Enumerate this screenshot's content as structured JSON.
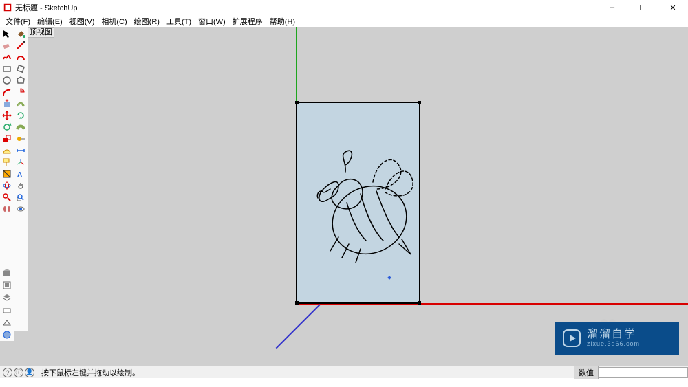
{
  "titlebar": {
    "title": "无标题 - SketchUp",
    "min": "–",
    "max": "☐",
    "close": "✕"
  },
  "menubar": {
    "items": [
      "文件(F)",
      "编辑(E)",
      "视图(V)",
      "相机(C)",
      "绘图(R)",
      "工具(T)",
      "窗口(W)",
      "扩展程序",
      "帮助(H)"
    ]
  },
  "viewport": {
    "label": "顶视图"
  },
  "statusbar": {
    "hint": "按下鼠标左键并拖动以绘制。",
    "measurement_label": "数值",
    "icons": [
      "①",
      "⊙",
      "⊙"
    ]
  },
  "tools_left": [
    {
      "name": "select",
      "col": 0
    },
    {
      "name": "paint-bucket",
      "col": 1
    },
    {
      "name": "eraser",
      "col": 0
    },
    {
      "name": "line",
      "col": 1
    },
    {
      "name": "freehand",
      "col": 0
    },
    {
      "name": "curve-red",
      "col": 1
    },
    {
      "name": "rectangle",
      "col": 0
    },
    {
      "name": "rotated-rect",
      "col": 1
    },
    {
      "name": "circle",
      "col": 0
    },
    {
      "name": "polygon",
      "col": 1
    },
    {
      "name": "arc-red",
      "col": 0
    },
    {
      "name": "pie-red",
      "col": 1
    },
    {
      "name": "pushpull",
      "col": 0
    },
    {
      "name": "offset",
      "col": 1
    },
    {
      "name": "move",
      "col": 0
    },
    {
      "name": "rotate",
      "col": 1
    },
    {
      "name": "rotate-green",
      "col": 0
    },
    {
      "name": "followme",
      "col": 1
    },
    {
      "name": "scale-red",
      "col": 0
    },
    {
      "name": "tape",
      "col": 1
    },
    {
      "name": "protractor-yellow",
      "col": 0
    },
    {
      "name": "dimension-blue",
      "col": 1
    },
    {
      "name": "text-yellow",
      "col": 0
    },
    {
      "name": "axes-blue",
      "col": 1
    },
    {
      "name": "section",
      "col": 0
    },
    {
      "name": "3dtext",
      "col": 1
    },
    {
      "name": "orbit-blue",
      "col": 0
    },
    {
      "name": "pan",
      "col": 1
    },
    {
      "name": "zoom-red",
      "col": 0
    },
    {
      "name": "zoom-extents",
      "col": 1
    },
    {
      "name": "walk",
      "col": 0
    },
    {
      "name": "lookaround",
      "col": 1
    }
  ],
  "tools_bottom": [
    {
      "name": "3d-warehouse"
    },
    {
      "name": "component"
    },
    {
      "name": "layers"
    },
    {
      "name": "outliner"
    },
    {
      "name": "model-info"
    },
    {
      "name": "add-location"
    }
  ],
  "watermark": {
    "main": "溜溜自学",
    "sub": "zixue.3d66.com"
  }
}
